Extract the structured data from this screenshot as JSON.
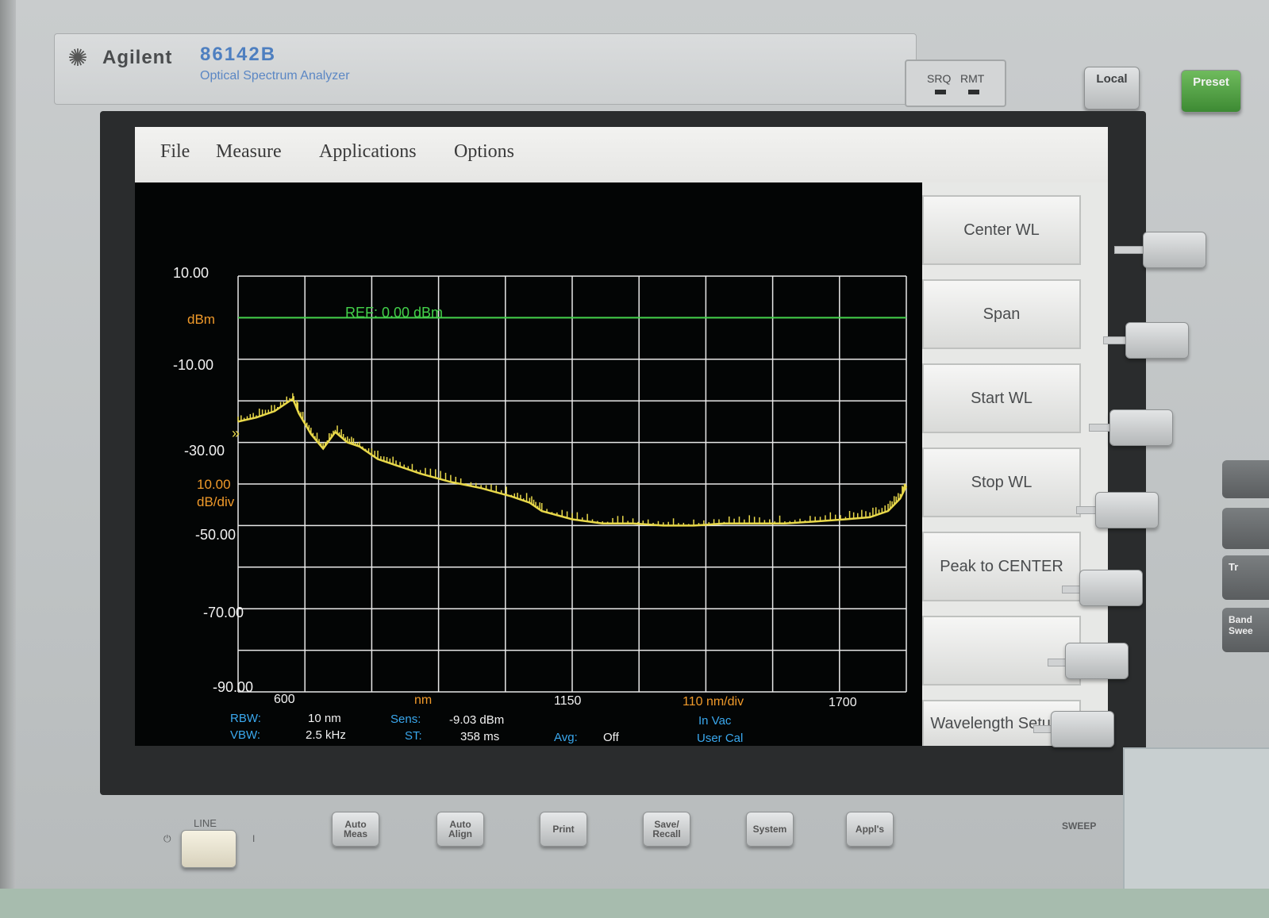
{
  "instrument": {
    "brand": "Agilent",
    "model": "86142B",
    "model_subtitle": "Optical Spectrum Analyzer",
    "srq_label": "SRQ",
    "rmt_label": "RMT",
    "local_label": "Local",
    "preset_label": "Preset",
    "line_label": "LINE",
    "sweep_label": "SWEEP",
    "power_off_symbol": "⏻",
    "power_on_symbol": "I",
    "bottom_buttons": [
      {
        "label": "Auto Meas"
      },
      {
        "label": "Auto Align"
      },
      {
        "label": "Print"
      },
      {
        "label": "Save/ Recall"
      },
      {
        "label": "System"
      },
      {
        "label": "Appl's"
      }
    ],
    "right_panel_buttons": [
      "Tr",
      "Band Swee"
    ]
  },
  "menubar": {
    "items": [
      "File",
      "Measure",
      "Applications",
      "Options"
    ]
  },
  "softkeys": [
    {
      "label": "Center WL"
    },
    {
      "label": "Span"
    },
    {
      "label": "Start WL"
    },
    {
      "label": "Stop WL"
    },
    {
      "label": "Peak to CENTER"
    },
    {
      "label": ""
    },
    {
      "label": "Wavelength Setup..."
    }
  ],
  "chart_data": {
    "type": "line",
    "x_unit": "nm",
    "y_unit": "dBm",
    "xlim": [
      600,
      1700
    ],
    "ylim": [
      -90,
      10
    ],
    "x_ticks": [
      "600",
      "1150",
      "1700"
    ],
    "x_unit_label": "nm",
    "x_scale_label": "110 nm/div",
    "y_ticks": [
      "10.00",
      "-10.00",
      "-30.00",
      "-50.00",
      "-70.00",
      "-90.00"
    ],
    "y_unit_label": "dBm",
    "y_scale_label": "10.00 dB/div",
    "reference_label": "REF: 0.00 dBm",
    "reference_value": 0,
    "grid": true,
    "trace_color": "#e8d84a",
    "reference_color": "#43d14a",
    "series": [
      {
        "x": [
          600,
          630,
          660,
          690,
          700,
          720,
          740,
          760,
          780,
          800,
          830,
          860,
          900,
          950,
          1000,
          1050,
          1080,
          1100,
          1150,
          1200,
          1250,
          1300,
          1350,
          1400,
          1450,
          1500,
          1550,
          1600,
          1640,
          1670,
          1690,
          1700
        ],
        "y": [
          -25,
          -24,
          -22.5,
          -19.5,
          -23,
          -28,
          -31.5,
          -27.5,
          -30,
          -31,
          -34,
          -35.5,
          -37.5,
          -39.5,
          -41,
          -43,
          -44.5,
          -46.5,
          -48.5,
          -49.5,
          -49.5,
          -50,
          -50,
          -49.5,
          -49.5,
          -49.5,
          -49,
          -48.5,
          -48,
          -46.5,
          -43.5,
          -40.5
        ]
      }
    ]
  },
  "status": {
    "rbw_label": "RBW:",
    "rbw_value": "10 nm",
    "vbw_label": "VBW:",
    "vbw_value": "2.5 kHz",
    "sens_label": "Sens:",
    "sens_value": "-9.03 dBm",
    "st_label": "ST:",
    "st_value": "358 ms",
    "avg_label": "Avg:",
    "avg_value": "Off",
    "medium": "In Vac",
    "cal": "User Cal"
  },
  "colors": {
    "screen_bg": "#030505",
    "axis_text": "#f2f2f2",
    "unit_text": "#f09a2a",
    "status_label": "#3aa8ee"
  }
}
